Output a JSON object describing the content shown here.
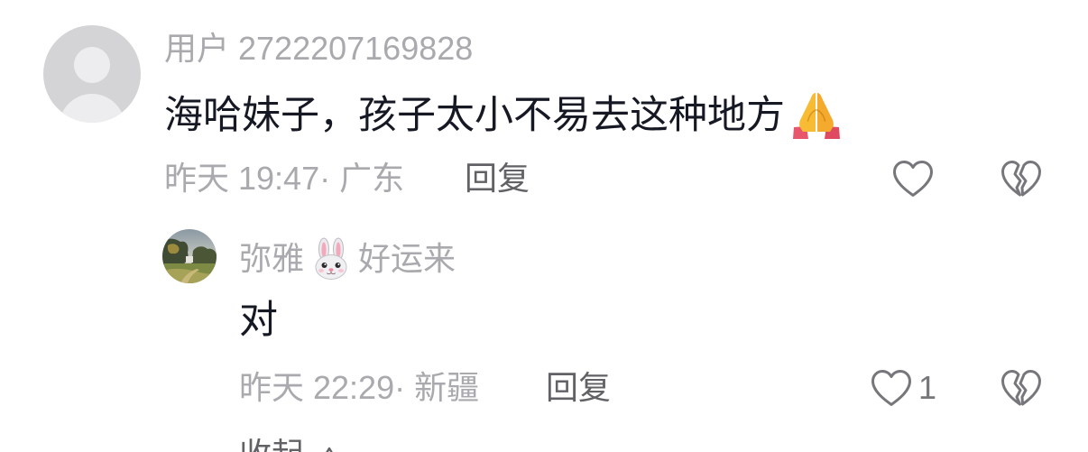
{
  "colors": {
    "text_primary": "#161823",
    "text_secondary": "#a9a9ae",
    "action_text": "#616166",
    "icon_stroke": "#76767b",
    "avatar_placeholder": "#d4d4d7",
    "avatar_silhouette": "#ededef"
  },
  "comment": {
    "avatar_icon": "default-user-avatar-icon",
    "username": "用户 2722207169828",
    "text": "海哈妹子，孩子太小不易去这种地方",
    "text_emoji_icon": "folded-hands-emoji-icon",
    "meta": "昨天 19:47· 广东",
    "reply_label": "回复",
    "like_icon": "heart-outline-icon",
    "dislike_icon": "broken-heart-icon"
  },
  "reply": {
    "avatar_icon": "landscape-photo-avatar-icon",
    "username_before_emoji": "弥雅",
    "username_emoji_icon": "rabbit-face-emoji-icon",
    "username_after_emoji": "好运来",
    "text": "对",
    "meta": "昨天 22:29· 新疆",
    "reply_label": "回复",
    "like_icon": "heart-outline-icon",
    "like_count": "1",
    "dislike_icon": "broken-heart-icon"
  },
  "collapse": {
    "label": "收起",
    "icon": "chevron-up-icon"
  }
}
